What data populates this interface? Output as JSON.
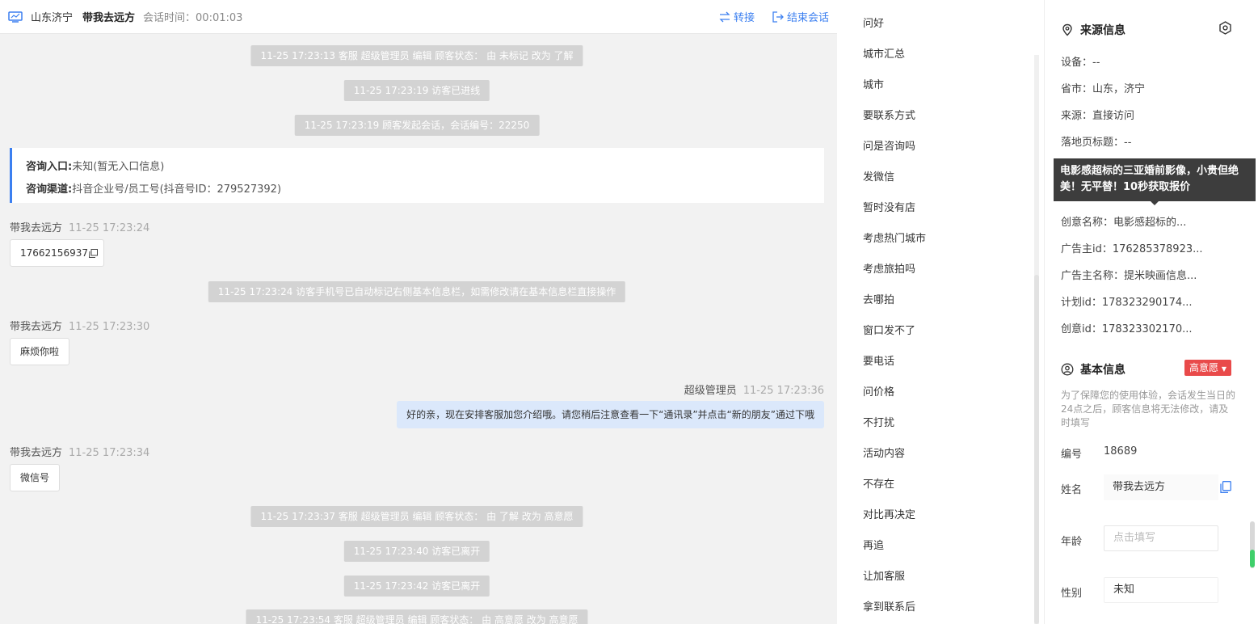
{
  "header": {
    "city": "山东济宁",
    "visitor": "带我去远方",
    "session_time": "会话时间：00:01:03",
    "transfer": "转接",
    "end_session": "结束会话"
  },
  "system_messages": [
    "11-25 17:23:13 客服 超级管理员 编辑 顾客状态： 由 未标记 改为 了解",
    "11-25 17:23:19 访客已进线",
    "11-25 17:23:19 顾客发起会话，会话编号：22250",
    "11-25 17:23:24 访客手机号已自动标记右侧基本信息栏，如需修改请在基本信息栏直接操作",
    "11-25 17:23:37 客服 超级管理员 编辑 顾客状态： 由 了解 改为 高意愿",
    "11-25 17:23:40 访客已离开",
    "11-25 17:23:42 访客已离开",
    "11-25 17:23:54 客服 超级管理员 编辑 顾客状态： 由 高意愿 改为 高意愿"
  ],
  "consult": {
    "entry_label": "咨询入口:",
    "entry_value": "未知(暂无入口信息)",
    "channel_label": "咨询渠道:",
    "channel_value": "抖音企业号/员工号(抖音号ID：279527392)"
  },
  "messages": [
    {
      "sender": "带我去远方",
      "time": "11-25 17:23:24",
      "text": "17662156937"
    },
    {
      "sender": "带我去远方",
      "time": "11-25 17:23:30",
      "text": "麻烦你啦"
    },
    {
      "sender": "超级管理员",
      "time": "11-25 17:23:36",
      "text": "好的亲，现在安排客服加您介绍哦。请您稍后注意查看一下“通讯录”并点击“新的朋友”通过下哦"
    },
    {
      "sender": "带我去远方",
      "time": "11-25 17:23:34",
      "text": "微信号"
    }
  ],
  "quick_replies": [
    "问好",
    "城市汇总",
    "城市",
    "要联系方式",
    "问是咨询吗",
    "发微信",
    "暂时没有店",
    "考虑热门城市",
    "考虑旅拍吗",
    "去哪拍",
    "窗口发不了",
    "要电话",
    "问价格",
    "不打扰",
    "活动内容",
    "不存在",
    "对比再决定",
    "再追",
    "让加客服",
    "拿到联系后"
  ],
  "source": {
    "title": "来源信息",
    "device": "设备：--",
    "province_city": "省市：山东，济宁",
    "source": "来源：直接访问",
    "landing_title": "落地页标题：--",
    "creative_name": "创意名称：电影感超标的...",
    "advertiser_id": "广告主id：176285378923...",
    "advertiser_name": "广告主名称：提米映画信息...",
    "plan_id": "计划id：178323290174...",
    "creative_id": "创意id：178323302170..."
  },
  "tooltip": "电影感超标的三亚婚前影像，小贵但绝美！无平替！10秒获取报价",
  "basic": {
    "title": "基本信息",
    "intent_badge": "高意愿",
    "note": "为了保障您的使用体验，会话发生当日的24点之后，顾客信息将无法修改，请及时填写",
    "id_label": "编号",
    "id_value": "18689",
    "name_label": "姓名",
    "name_value": "带我去远方",
    "age_label": "年龄",
    "age_placeholder": "点击填写",
    "gender_label": "性别",
    "gender_value": "未知"
  },
  "colors": {
    "accent": "#3b7ff0",
    "badge_red": "#e94a4a",
    "agent_bubble": "#dbe8fb",
    "system_bg": "#d3d3d3"
  }
}
